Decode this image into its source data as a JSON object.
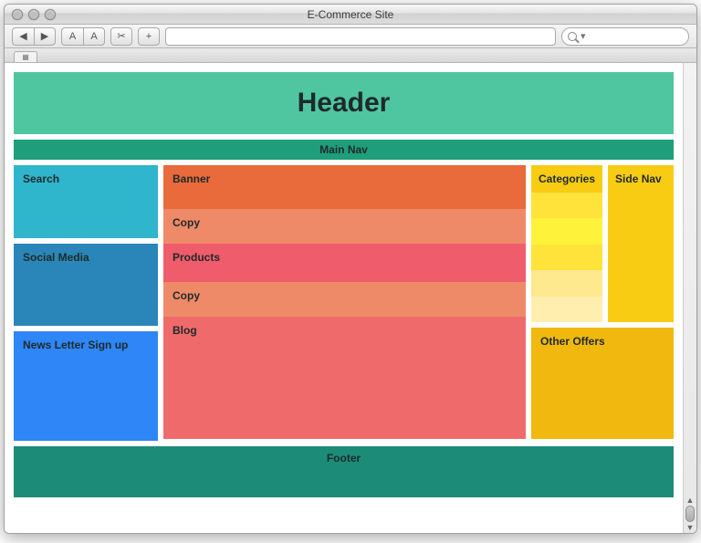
{
  "window": {
    "title": "E-Commerce Site"
  },
  "toolbar": {
    "back_glyph": "◀",
    "forward_glyph": "▶",
    "font_small": "A",
    "font_large": "A",
    "cut_glyph": "✂",
    "plus_glyph": "+",
    "search_placeholder": "",
    "search_dropdown_glyph": "▾"
  },
  "layout": {
    "header": "Header",
    "main_nav": "Main Nav",
    "left": {
      "search": "Search",
      "social": "Social Media",
      "newsletter": "News Letter Sign up"
    },
    "center": {
      "banner": "Banner",
      "copy1": "Copy",
      "products": "Products",
      "copy2": "Copy",
      "blog": "Blog"
    },
    "right": {
      "categories": "Categories",
      "side_nav": "Side Nav",
      "other_offers": "Other Offers"
    },
    "footer": "Footer"
  }
}
